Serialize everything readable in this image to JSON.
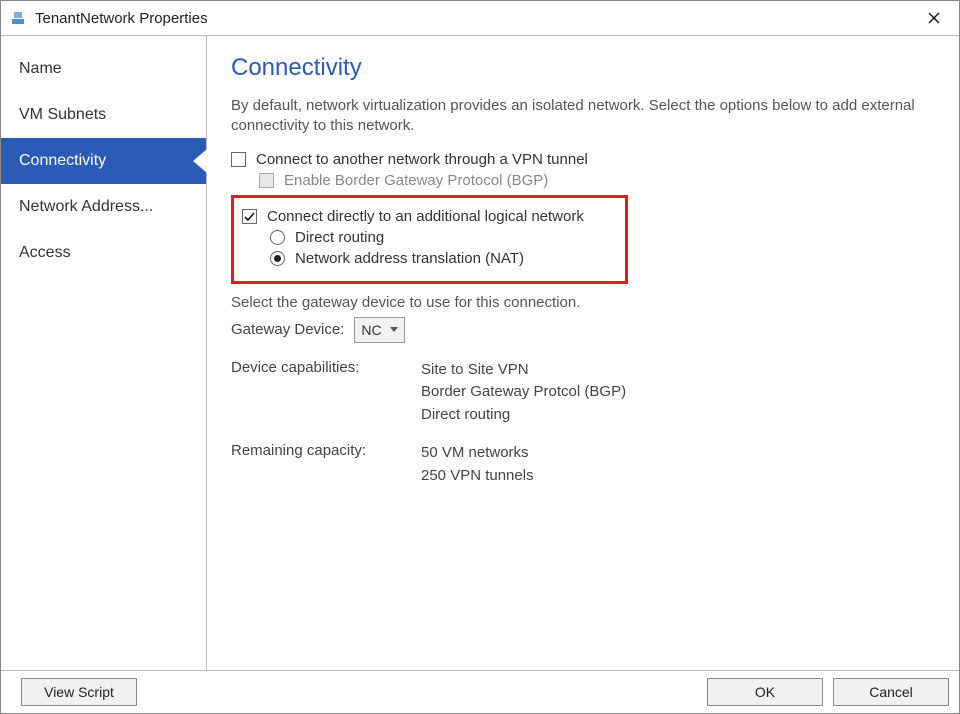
{
  "window": {
    "title": "TenantNetwork Properties"
  },
  "sidebar": {
    "items": [
      {
        "label": "Name"
      },
      {
        "label": "VM Subnets"
      },
      {
        "label": "Connectivity"
      },
      {
        "label": "Network Address..."
      },
      {
        "label": "Access"
      }
    ],
    "selectedIndex": 2
  },
  "page": {
    "title": "Connectivity",
    "intro": "By default, network virtualization provides an isolated network. Select the options below to add external connectivity to this network.",
    "vpn": {
      "label": "Connect to another network through a VPN tunnel",
      "checked": false,
      "bgpLabel": "Enable Border Gateway Protocol (BGP)",
      "bgpEnabled": false
    },
    "direct": {
      "label": "Connect directly to an additional logical network",
      "checked": true,
      "routingLabel": "Direct routing",
      "natLabel": "Network address translation (NAT)",
      "selected": "nat"
    },
    "gatewayPrompt": "Select the gateway device to use for this connection.",
    "gateway": {
      "label": "Gateway Device:",
      "value": "NC"
    },
    "caps": {
      "label": "Device capabilities:",
      "v1": "Site to Site VPN",
      "v2": "Border Gateway Protcol (BGP)",
      "v3": "Direct routing"
    },
    "remaining": {
      "label": "Remaining capacity:",
      "v1": "50 VM networks",
      "v2": "250 VPN tunnels"
    }
  },
  "footer": {
    "viewScript": "View Script",
    "ok": "OK",
    "cancel": "Cancel"
  }
}
